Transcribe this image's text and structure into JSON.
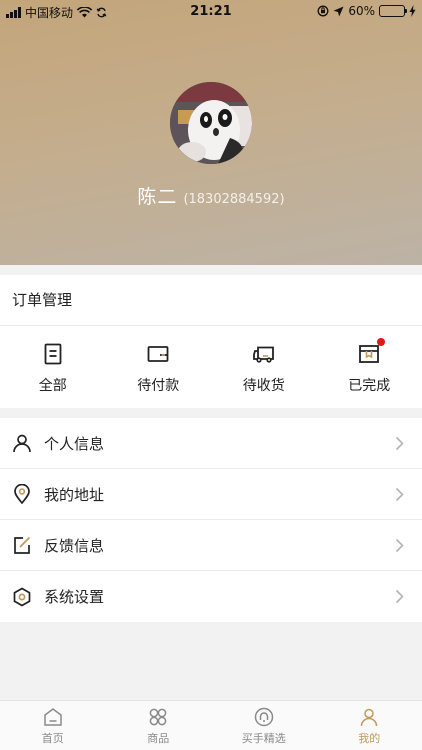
{
  "status_bar": {
    "carrier": "中国移动",
    "time": "21:21",
    "battery": "60%",
    "battery_level": 0.6
  },
  "profile": {
    "name": "陈二",
    "phone": "(18302884592)"
  },
  "orders": {
    "title": "订单管理",
    "items": [
      {
        "label": "全部",
        "icon": "document-icon"
      },
      {
        "label": "待付款",
        "icon": "wallet-icon"
      },
      {
        "label": "待收货",
        "icon": "truck-icon"
      },
      {
        "label": "已完成",
        "icon": "box-icon",
        "has_badge": true
      }
    ]
  },
  "menu": {
    "items": [
      {
        "label": "个人信息",
        "icon": "person-icon"
      },
      {
        "label": "我的地址",
        "icon": "location-pin-icon"
      },
      {
        "label": "反馈信息",
        "icon": "edit-icon"
      },
      {
        "label": "系统设置",
        "icon": "settings-hexagon-icon"
      }
    ]
  },
  "tabbar": {
    "items": [
      {
        "label": "首页",
        "icon": "home-icon"
      },
      {
        "label": "商品",
        "icon": "grid-clover-icon"
      },
      {
        "label": "买手精选",
        "icon": "selection-icon"
      },
      {
        "label": "我的",
        "icon": "person-icon",
        "active": true
      }
    ]
  },
  "colors": {
    "accent": "#c19a5b",
    "badge": "#e01818",
    "battery": "#35c759"
  }
}
